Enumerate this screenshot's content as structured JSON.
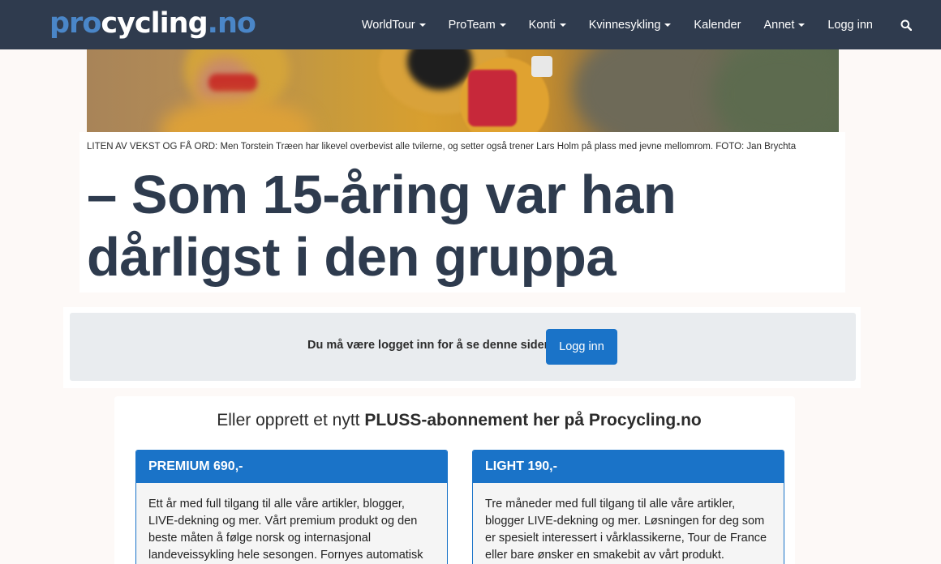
{
  "navbar": {
    "logo": {
      "part1": "pro",
      "part2": "cycling",
      "part3": ".no"
    },
    "items": [
      {
        "label": "WorldTour",
        "dropdown": true
      },
      {
        "label": "ProTeam",
        "dropdown": true
      },
      {
        "label": "Konti",
        "dropdown": true
      },
      {
        "label": "Kvinnesykling",
        "dropdown": true
      },
      {
        "label": "Kalender",
        "dropdown": false
      },
      {
        "label": "Annet",
        "dropdown": true
      },
      {
        "label": "Logg inn",
        "dropdown": false
      }
    ],
    "search_icon": "search-icon"
  },
  "article": {
    "caption": "LITEN AV VEKST OG FÅ ORD: Men Torstein Træen har likevel overbevist alle tvilerne, og setter også trener Lars Holm på plass med jevne mellomrom. FOTO: Jan Brychta",
    "headline_line1": "– Som 15-åring var han",
    "headline_line2": "dårligst i den gruppa"
  },
  "login": {
    "message": "Du må være logget inn for å se denne siden",
    "button_label": "Logg inn"
  },
  "subscription": {
    "title_prefix": "Eller opprett et nytt ",
    "title_bold": "PLUSS-abonnement her på Procycling.no",
    "plans": [
      {
        "name": "PREMIUM 690,-",
        "description": "Ett år med full tilgang til alle våre artikler, blogger, LIVE-dekning og mer. Vårt premium produkt og den beste måten å følge norsk og internasjonal landeveissykling hele sesongen. Fornyes automatisk"
      },
      {
        "name": "LIGHT 190,-",
        "description": "Tre måneder med full tilgang til alle våre artikler, blogger LIVE-dekning og mer. Løsningen for deg som er spesielt interessert i vårklassikerne, Tour de France eller bare ønsker en smakebit av vårt produkt."
      }
    ]
  },
  "colors": {
    "navbar_bg": "#2f3b4e",
    "brand_blue": "#1a73c8",
    "headline": "#2e3b4e",
    "login_panel_bg": "#e9ecef"
  }
}
